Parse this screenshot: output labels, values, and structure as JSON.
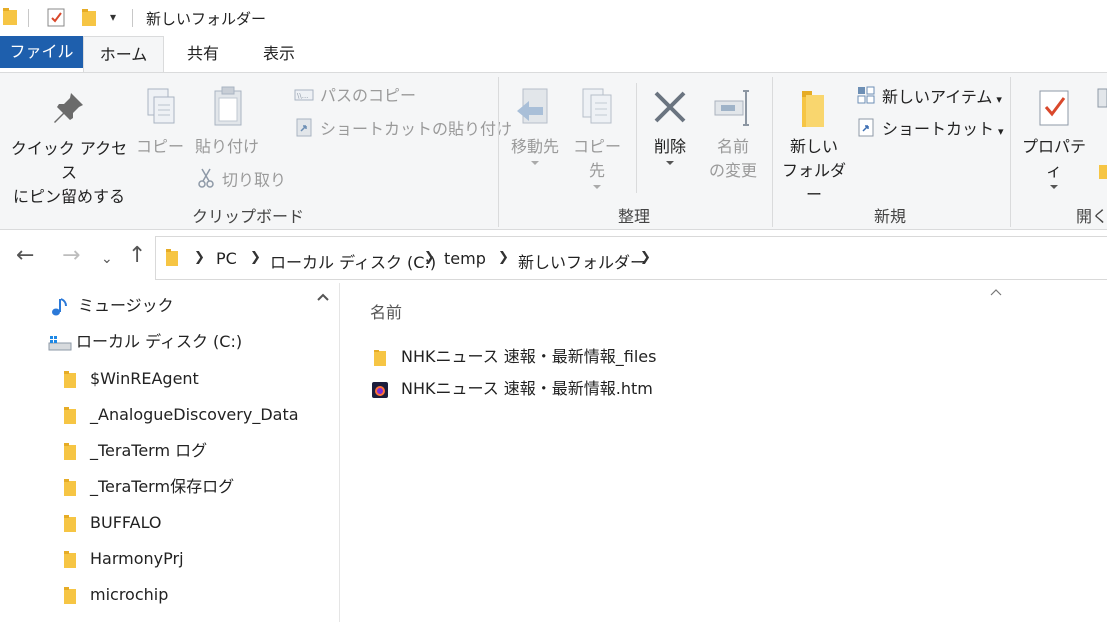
{
  "window": {
    "title": "新しいフォルダー"
  },
  "tabs": {
    "file": "ファイル",
    "home": "ホーム",
    "share": "共有",
    "view": "表示"
  },
  "ribbon": {
    "clipboard": {
      "pin_line1": "クイック アクセス",
      "pin_line2": "にピン留めする",
      "copy": "コピー",
      "paste": "貼り付け",
      "copy_path": "パスのコピー",
      "paste_shortcut": "ショートカットの貼り付け",
      "cut": "切り取り",
      "label": "クリップボード"
    },
    "organize": {
      "move_to": "移動先",
      "copy_to": "コピー先",
      "delete": "削除",
      "rename_line1": "名前",
      "rename_line2": "の変更",
      "label": "整理"
    },
    "new": {
      "folder_line1": "新しい",
      "folder_line2": "フォルダー",
      "new_item": "新しいアイテム",
      "shortcut": "ショートカット",
      "label": "新規"
    },
    "open": {
      "properties": "プロパティ",
      "label": "開く"
    }
  },
  "address": {
    "crumbs": [
      "PC",
      "ローカル ディスク (C:)",
      "temp",
      "新しいフォルダー"
    ]
  },
  "navpane": {
    "items": [
      {
        "label": "ミュージック",
        "icon": "music-icon"
      },
      {
        "label": "ローカル ディスク (C:)",
        "icon": "drive-icon"
      },
      {
        "label": "$WinREAgent",
        "icon": "folder-icon"
      },
      {
        "label": "_AnalogueDiscovery_Data",
        "icon": "folder-icon"
      },
      {
        "label": "_TeraTerm ログ",
        "icon": "folder-icon"
      },
      {
        "label": "_TeraTerm保存ログ",
        "icon": "folder-icon"
      },
      {
        "label": "BUFFALO",
        "icon": "folder-icon"
      },
      {
        "label": "HarmonyPrj",
        "icon": "folder-icon"
      },
      {
        "label": "microchip",
        "icon": "folder-icon"
      }
    ]
  },
  "content": {
    "column_name": "名前",
    "files": [
      {
        "name": "NHKニュース 速報・最新情報_files",
        "icon": "folder-icon"
      },
      {
        "name": "NHKニュース 速報・最新情報.htm",
        "icon": "html-file-icon"
      }
    ]
  },
  "colors": {
    "accent": "#1e5fad",
    "folder": "#f6c544",
    "ribbon_bg": "#f5f6f7"
  }
}
